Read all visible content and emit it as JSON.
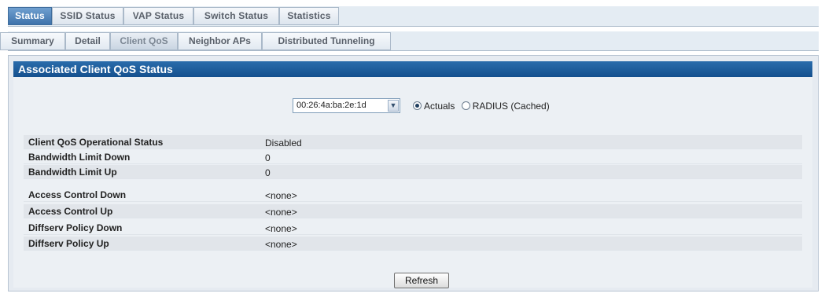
{
  "tabs": {
    "primary": [
      "Status",
      "SSID Status",
      "VAP Status",
      "Switch Status",
      "Statistics"
    ],
    "secondary": [
      "Summary",
      "Detail",
      "Client QoS",
      "Neighbor APs",
      "Distributed Tunneling"
    ],
    "active_primary": "Status",
    "active_secondary": "Client QoS"
  },
  "panel": {
    "title": "Associated Client QoS Status",
    "client_select_value": "00:26:4a:ba:2e:1d",
    "source_options": [
      "Actuals",
      "RADIUS (Cached)"
    ],
    "source_selected": "Actuals"
  },
  "fields": [
    {
      "label": "Client QoS Operational Status",
      "value": "Disabled"
    },
    {
      "label": "Bandwidth Limit Down",
      "value": "0"
    },
    {
      "label": "Bandwidth Limit Up",
      "value": "0"
    },
    {
      "label": "Access Control Down",
      "value": "<none>"
    },
    {
      "label": "Access Control Up",
      "value": "<none>"
    },
    {
      "label": "Diffserv Policy Down",
      "value": "<none>"
    },
    {
      "label": "Diffserv Policy Up",
      "value": "<none>"
    }
  ],
  "refresh_label": "Refresh",
  "colors": {
    "active_tab": "#3f73ab",
    "panel_header": "#1b5c9c"
  }
}
